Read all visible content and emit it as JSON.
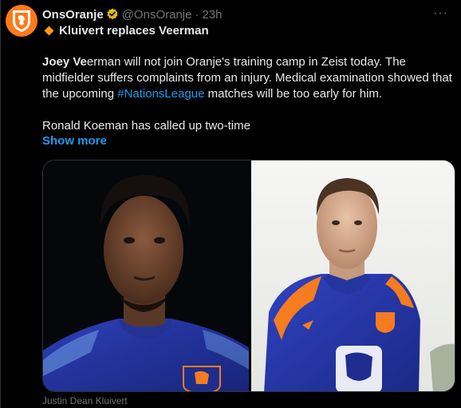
{
  "author": {
    "name": "OnsOranje",
    "handle": "@OnsOranje",
    "separator": "·",
    "time": "23h",
    "avatar_icon": "lion-crest-icon",
    "verified_icon": "verified-badge-icon"
  },
  "more_label": "···",
  "headline": {
    "icon": "orange-diamond-icon",
    "text": "Kluivert replaces Veerman"
  },
  "body": {
    "p1_bold": "Joey Ve",
    "p1_a": "erman will not join Oranje's training camp in Zeist today. The midfielder suffers complaints from an injury. Medical examination showed that the upcoming ",
    "hashtag": "#NationsLeague",
    "p1_b": " matches will be too early for him.",
    "p2": "Ronald Koeman has called up two-time"
  },
  "show_more": "Show more",
  "media": {
    "photos": [
      {
        "subject": "player-portrait-dark-background"
      },
      {
        "subject": "player-portrait-light-background"
      }
    ]
  },
  "caption": "Justin Dean Kluivert",
  "colors": {
    "background": "#000000",
    "text": "#e7e9ea",
    "muted": "#71767b",
    "link": "#1d9bf0",
    "brand_orange": "#ff7a1a",
    "kit_blue": "#2a3fb8"
  }
}
